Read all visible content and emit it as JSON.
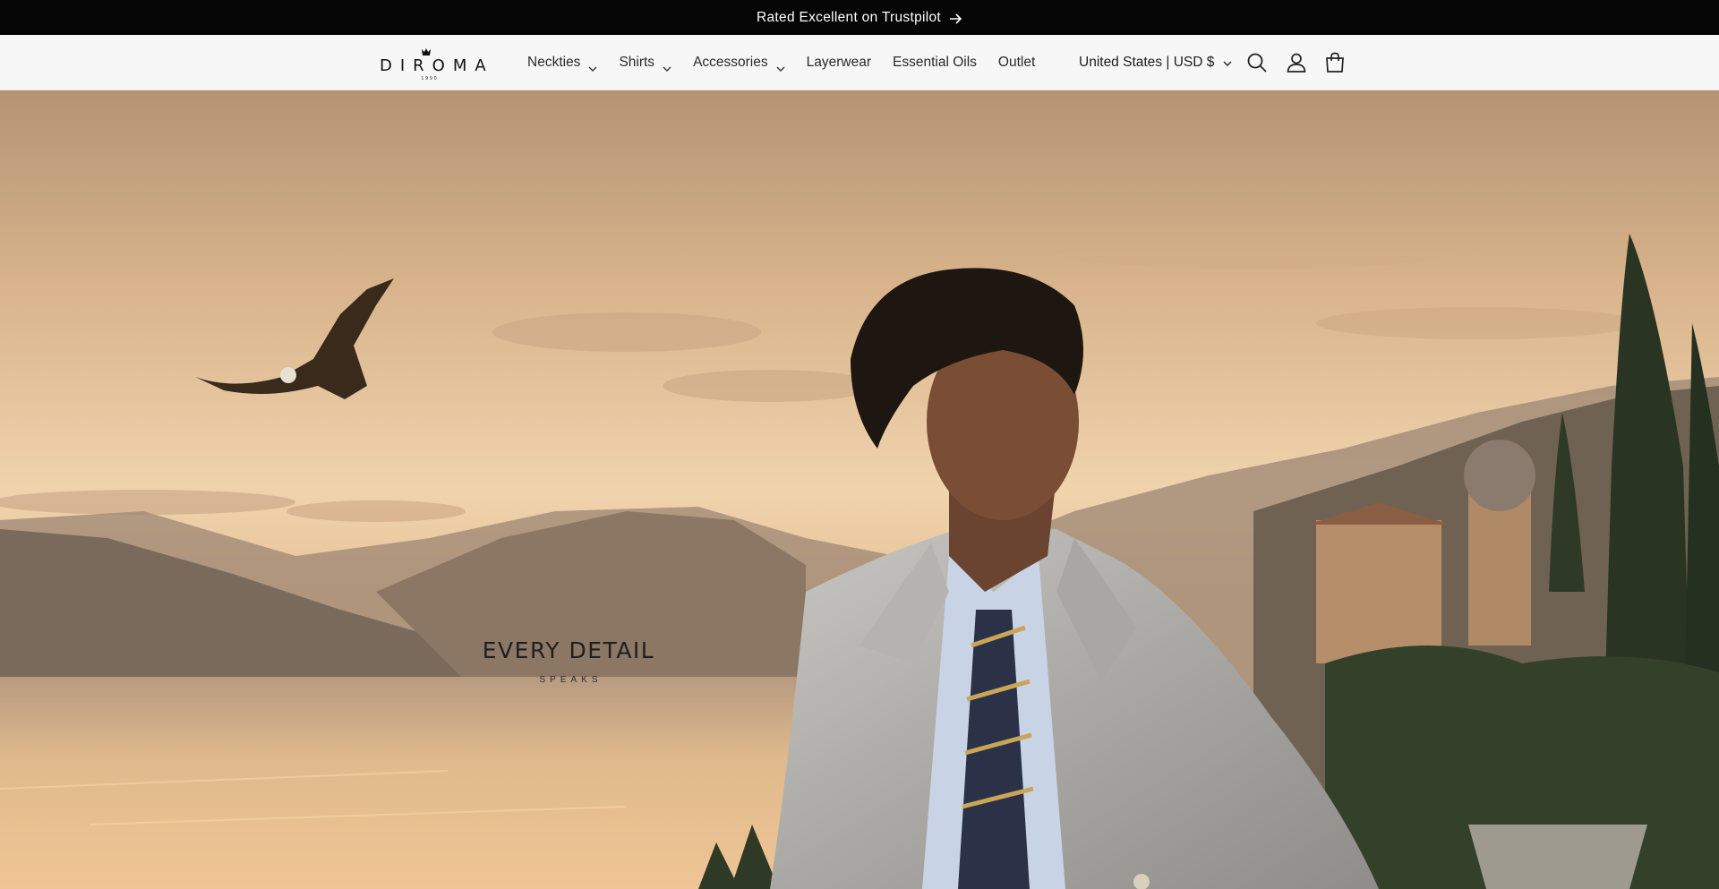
{
  "announcement": {
    "text": "Rated Excellent on Trustpilot",
    "icon": "arrow-right-icon"
  },
  "header": {
    "logo": {
      "wordmark": "DIROMA",
      "year": "1990"
    },
    "nav": [
      {
        "label": "Neckties",
        "has_dropdown": true
      },
      {
        "label": "Shirts",
        "has_dropdown": true
      },
      {
        "label": "Accessories",
        "has_dropdown": true
      },
      {
        "label": "Layerwear",
        "has_dropdown": false
      },
      {
        "label": "Essential Oils",
        "has_dropdown": false
      },
      {
        "label": "Outlet",
        "has_dropdown": false
      }
    ],
    "country_selector": "United States | USD $",
    "icons": [
      "search-icon",
      "account-icon",
      "cart-icon"
    ]
  },
  "hero": {
    "heading": "EVERY DETAIL",
    "subheading": "SPEAKS"
  },
  "colors": {
    "announcement_bg": "#050505",
    "header_bg": "#f7f7f7",
    "text": "#1f1f1f"
  }
}
